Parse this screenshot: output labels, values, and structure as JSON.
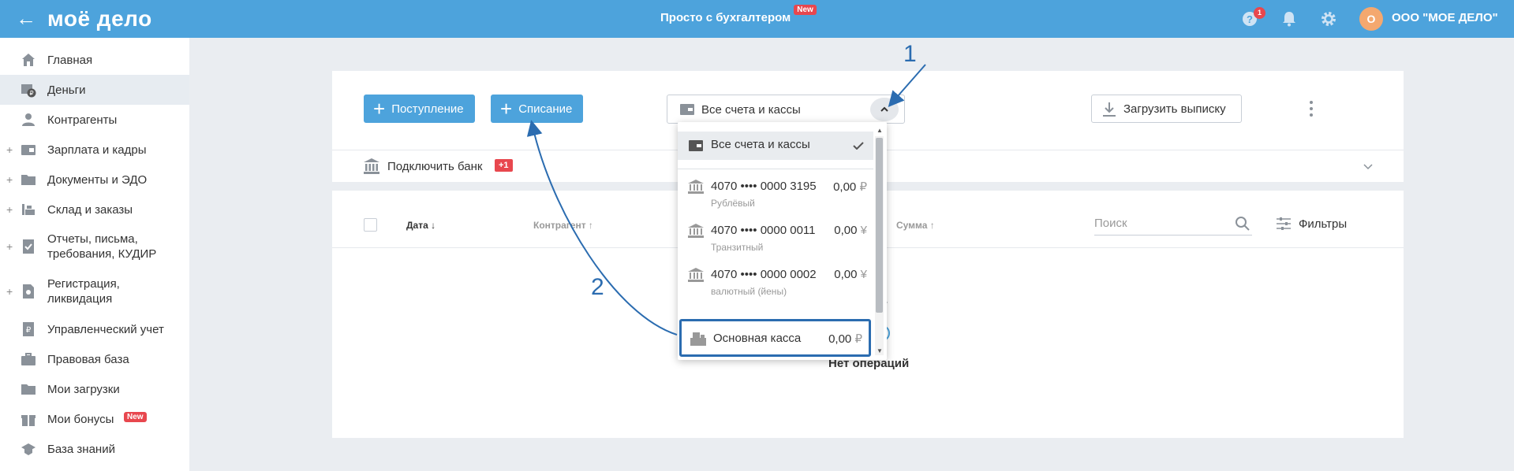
{
  "header": {
    "logo": "моё дело",
    "promo": "Просто с бухгалтером",
    "promo_badge": "New",
    "help_count": "1",
    "avatar_initial": "О",
    "org_name": "ООО \"МОЕ ДЕЛО\"",
    "bg_color": "#4da3dc"
  },
  "sidebar": {
    "items": [
      {
        "label": "Главная",
        "icon": "home-icon"
      },
      {
        "label": "Деньги",
        "icon": "money-icon",
        "active": true
      },
      {
        "label": "Контрагенты",
        "icon": "contacts-icon"
      },
      {
        "label": "Зарплата и кадры",
        "icon": "salary-icon",
        "expandable": true
      },
      {
        "label": "Документы и ЭДО",
        "icon": "folder-icon",
        "expandable": true
      },
      {
        "label": "Склад и заказы",
        "icon": "warehouse-icon",
        "expandable": true
      },
      {
        "label": "Отчеты, письма, требования, КУДИР",
        "icon": "reports-icon",
        "expandable": true
      },
      {
        "label": "Регистрация, ликвидация",
        "icon": "registration-icon",
        "expandable": true
      },
      {
        "label": "Управленческий учет",
        "icon": "management-icon"
      },
      {
        "label": "Правовая база",
        "icon": "briefcase-icon"
      },
      {
        "label": "Мои загрузки",
        "icon": "folder-icon"
      },
      {
        "label": "Мои бонусы",
        "icon": "gift-icon",
        "badge": "New"
      },
      {
        "label": "База знаний",
        "icon": "graduation-cap-icon"
      }
    ]
  },
  "toolbar": {
    "income_label": "Поступление",
    "expense_label": "Списание",
    "account_select_value": "Все счета и кассы",
    "upload_label": "Загрузить выписку"
  },
  "bank_row": {
    "label": "Подключить банк",
    "badge": "+1"
  },
  "table": {
    "columns": {
      "date": "Дата ↓",
      "counterparty": "Контрагент ↑",
      "amount": "Сумма ↑"
    },
    "search_placeholder": "Поиск",
    "filters_label": "Фильтры",
    "empty_text": "Нет операций"
  },
  "dropdown": {
    "all": "Все счета и кассы",
    "accounts": [
      {
        "number": "4070 •••• 0000 3195",
        "type": "Рублёвый",
        "amount": "0,00",
        "currency": "₽"
      },
      {
        "number": "4070 •••• 0000 0011",
        "type": "Транзитный",
        "amount": "0,00",
        "currency": "¥"
      },
      {
        "number": "4070 •••• 0000 0002",
        "type": "валютный (йены)",
        "amount": "0,00",
        "currency": "¥"
      }
    ],
    "cash": {
      "name": "Основная касса",
      "amount": "0,00",
      "currency": "₽"
    }
  },
  "annotations": {
    "step1": "1",
    "step2": "2",
    "color": "#2b6cb0"
  }
}
